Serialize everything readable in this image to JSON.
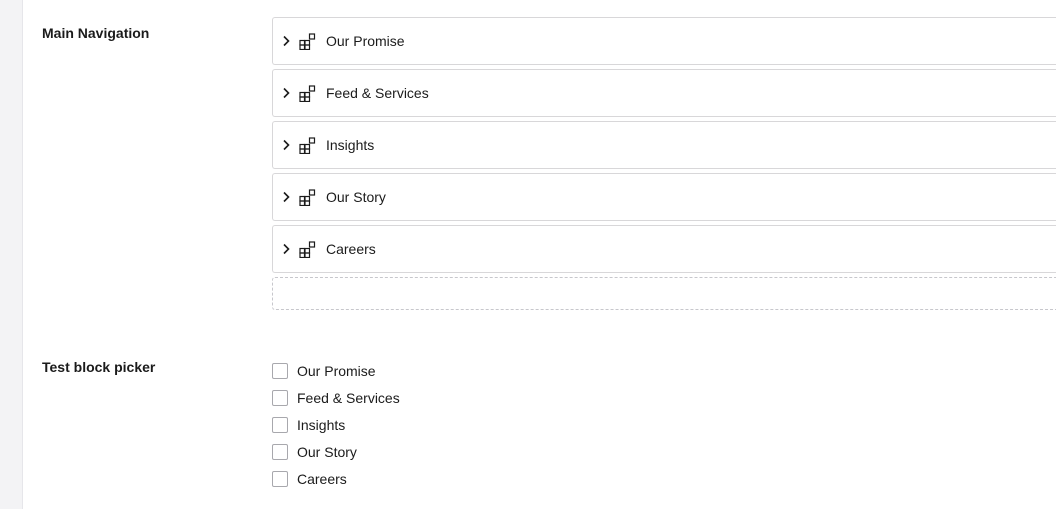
{
  "main_navigation": {
    "label": "Main Navigation",
    "items": [
      {
        "label": "Our Promise",
        "icon": "chevron-right-icon"
      },
      {
        "label": "Feed & Services",
        "icon": "chevron-right-icon"
      },
      {
        "label": "Insights",
        "icon": "chevron-right-icon"
      },
      {
        "label": "Our Story",
        "icon": "chevron-right-icon"
      },
      {
        "label": "Careers",
        "icon": "chevron-right-icon"
      }
    ],
    "block_icon": "block-grid-icon"
  },
  "test_block_picker": {
    "label": "Test block picker",
    "options": [
      {
        "label": "Our Promise",
        "checked": false
      },
      {
        "label": "Feed & Services",
        "checked": false
      },
      {
        "label": "Insights",
        "checked": false
      },
      {
        "label": "Our Story",
        "checked": false
      },
      {
        "label": "Careers",
        "checked": false
      }
    ]
  },
  "colors": {
    "background": "#f3f3f5",
    "panel": "#ffffff",
    "border": "#d8d7d9",
    "text": "#1b1b1b"
  }
}
